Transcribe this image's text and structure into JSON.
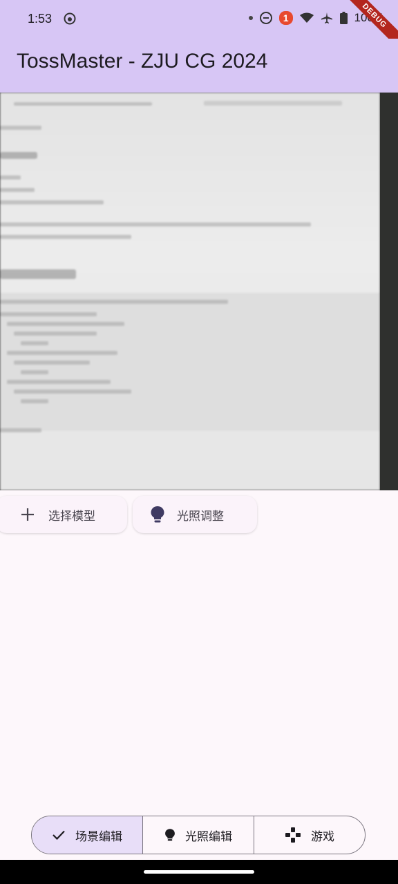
{
  "status_bar": {
    "time": "1:53",
    "notification_count": "1",
    "battery": "100%",
    "icons": [
      "app-notification-icon",
      "dot-icon",
      "do-not-disturb-icon",
      "wifi-icon",
      "airplane-icon",
      "battery-icon"
    ]
  },
  "debug_banner": "DEBUG",
  "app_bar": {
    "title": "TossMaster - ZJU CG 2024"
  },
  "camera_preview": {
    "description_icon": "camera-preview"
  },
  "chips": {
    "select_model": "选择模型",
    "lighting_adjust": "光照调整"
  },
  "segmented": {
    "items": [
      {
        "label": "场景编辑",
        "icon": "check-icon",
        "selected": true
      },
      {
        "label": "光照编辑",
        "icon": "lightbulb-icon",
        "selected": false
      },
      {
        "label": "游戏",
        "icon": "gamepad-icon",
        "selected": false
      }
    ]
  },
  "colors": {
    "app_bar": "#d7c6f5",
    "selected_segment": "#e8def8",
    "background": "#fdf7fb"
  }
}
